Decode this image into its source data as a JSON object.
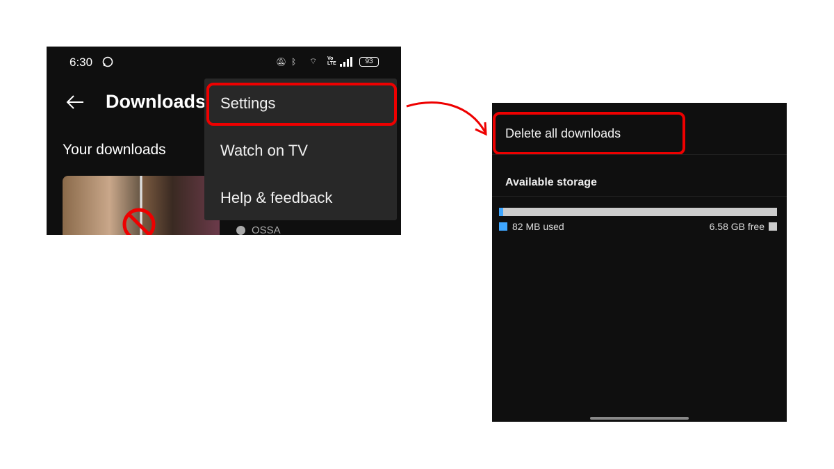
{
  "left_screen": {
    "status_bar": {
      "time": "6:30",
      "battery": "93",
      "icons": [
        "whatsapp-icon",
        "mute-bell-icon",
        "bluetooth-icon",
        "wifi-icon",
        "volte-icon",
        "signal-icon",
        "battery-icon"
      ]
    },
    "header": {
      "title": "Downloads",
      "back_icon": "arrow-left-icon"
    },
    "section_title": "Your downloads",
    "video_channel": "OSSA",
    "menu": {
      "items": [
        {
          "label": "Settings",
          "highlighted": true
        },
        {
          "label": "Watch on TV"
        },
        {
          "label": "Help & feedback"
        }
      ]
    }
  },
  "right_screen": {
    "delete_all_label": "Delete all downloads",
    "storage_title": "Available storage",
    "used_label": "82 MB used",
    "free_label": "6.58 GB free",
    "used_fraction": 0.012,
    "colors": {
      "used": "#3ea6ff",
      "free": "#cccccc",
      "highlight": "#e00000"
    }
  }
}
